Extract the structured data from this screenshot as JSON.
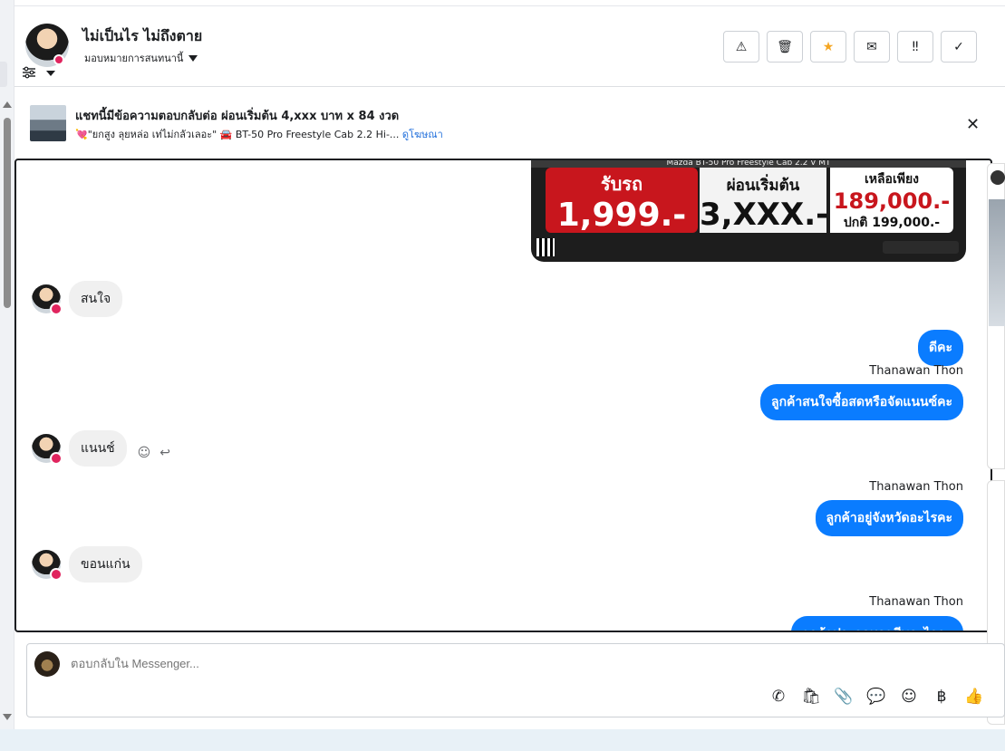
{
  "header": {
    "contact_name": "ไม่เป็นไร ไม่ถึงตาย",
    "assign_label": "มอบหมายการสนทนานี้",
    "actions": [
      {
        "icon": "warning-icon",
        "glyph": "⚠"
      },
      {
        "icon": "trash-icon",
        "glyph": "🗑"
      },
      {
        "icon": "star-icon",
        "glyph": "★"
      },
      {
        "icon": "mail-icon",
        "glyph": "✉"
      },
      {
        "icon": "follow-up-icon",
        "glyph": "‼"
      },
      {
        "icon": "check-icon",
        "glyph": "✓"
      }
    ]
  },
  "ad": {
    "title": "แชทนี้มีข้อความตอบกลับต่อ ผ่อนเริ่มต้น 4,xxx บาท x 84 งวด",
    "subtitle": "💘\"ยกสูง ลุยหล่อ เท่ไม่กลัวเลอะ\" 🚘 BT-50 Pro Freestyle Cab 2.2 Hi-...",
    "link": "ดูโฆษณา",
    "close_glyph": "✕"
  },
  "banner": {
    "top_text": "Mazda BT-50 Pro Freestyle Cab 2.2 V MT",
    "red_label": "รับรถ",
    "red_price": "1,999.-",
    "mid_label": "ผ่อนเริ่มต้น",
    "mid_price": "3,XXX.-",
    "right_label": "เหลือเพียง",
    "right_price": "189,000.-",
    "right_normal": "ปกติ 199,000.-"
  },
  "messages": {
    "in_1": "สนใจ",
    "out_1": "ดีคะ",
    "sender_1": "Thanawan Thon",
    "out_2": "ลูกค้าสนใจซื้อสดหรือจัดแนนซ์คะ",
    "in_2": "แนนช์",
    "sender_2": "Thanawan Thon",
    "out_3": "ลูกค้าอยู่จังหวัดอะไรคะ",
    "in_3": "ขอนแก่น",
    "sender_3": "Thanawan Thon",
    "out_4": "ลูกค้าประกอบอาชีพอะไรคะ"
  },
  "reactions": {
    "emoji_glyph": "☺",
    "reply_glyph": "↩"
  },
  "composer": {
    "placeholder": "ตอบกลับใน Messenger...",
    "tools": [
      {
        "icon": "phone-icon",
        "glyph": "✆"
      },
      {
        "icon": "shopping-bag-icon",
        "glyph": "🛍"
      },
      {
        "icon": "attachment-icon",
        "glyph": "📎"
      },
      {
        "icon": "chat-bubble-icon",
        "glyph": "💬"
      },
      {
        "icon": "emoji-icon",
        "glyph": "☺"
      },
      {
        "icon": "baht-icon",
        "glyph": "฿"
      },
      {
        "icon": "thumbs-up-icon",
        "glyph": "👍"
      }
    ]
  }
}
